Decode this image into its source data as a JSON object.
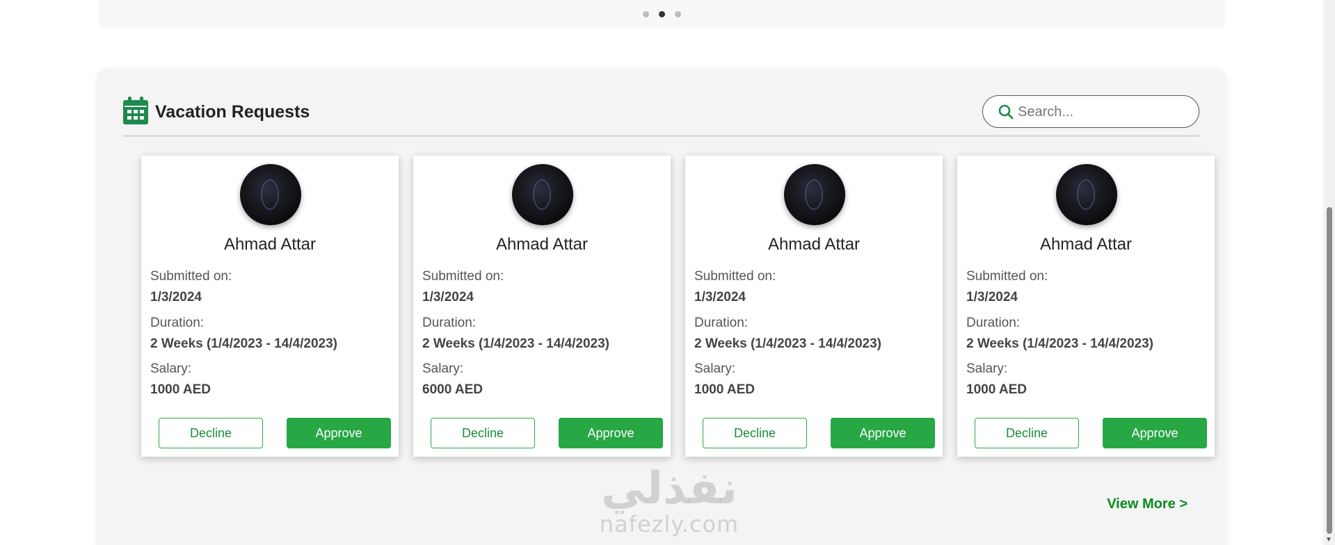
{
  "carousel": {
    "dots": [
      false,
      true,
      false
    ]
  },
  "section": {
    "title": "Vacation Requests",
    "icon": "calendar-icon",
    "accent": "#1e8a4c",
    "search": {
      "placeholder": "Search...",
      "value": ""
    }
  },
  "labels": {
    "submitted": "Submitted on:",
    "duration": "Duration:",
    "salary": "Salary:",
    "decline": "Decline",
    "approve": "Approve"
  },
  "requests": [
    {
      "name": "Ahmad Attar",
      "submitted": "1/3/2024",
      "duration": "2 Weeks (1/4/2023 - 14/4/2023)",
      "salary": "1000 AED"
    },
    {
      "name": "Ahmad Attar",
      "submitted": "1/3/2024",
      "duration": "2 Weeks (1/4/2023 - 14/4/2023)",
      "salary": "6000 AED"
    },
    {
      "name": "Ahmad Attar",
      "submitted": "1/3/2024",
      "duration": "2 Weeks (1/4/2023 - 14/4/2023)",
      "salary": "1000 AED"
    },
    {
      "name": "Ahmad Attar",
      "submitted": "1/3/2024",
      "duration": "2 Weeks (1/4/2023 - 14/4/2023)",
      "salary": "1000 AED"
    }
  ],
  "view_more": "View More >",
  "watermark": {
    "arabic": "نفذلي",
    "latin": "nafezly.com"
  },
  "colors": {
    "approve": "#28a745",
    "link": "#0b8a1e"
  }
}
